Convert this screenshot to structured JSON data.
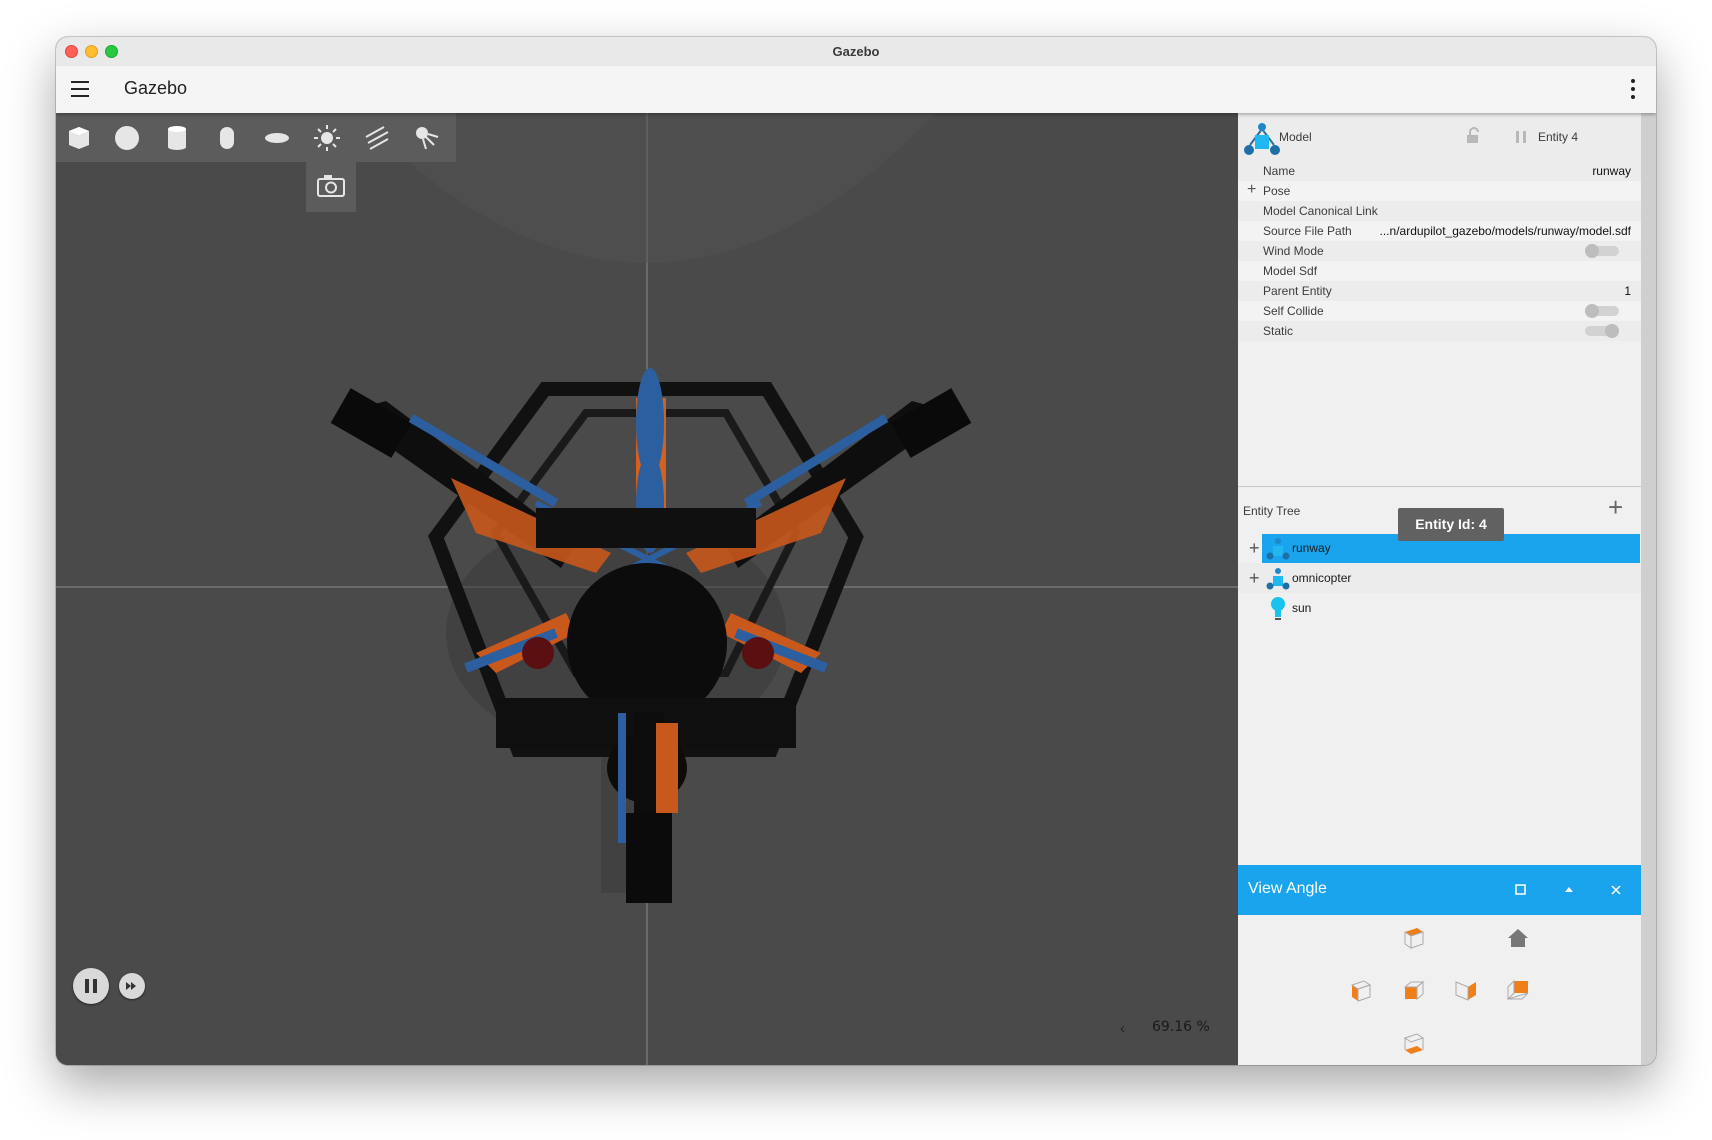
{
  "window": {
    "title": "Gazebo"
  },
  "appbar": {
    "title": "Gazebo",
    "menu_icon": "hamburger-icon",
    "overflow_icon": "kebab-menu-icon"
  },
  "toolbar": {
    "shapes": [
      "box",
      "sphere",
      "cylinder",
      "capsule",
      "ellipsoid",
      "sun-light",
      "directional-light",
      "spot-light"
    ],
    "screenshot": "camera-icon"
  },
  "playback": {
    "play_pause": "pause-icon",
    "step": "fast-forward-icon"
  },
  "stats": {
    "real_time_factor": "69.16 %",
    "collapse_arrow": "‹"
  },
  "component_inspector": {
    "type": "Model",
    "entity": "Entity 4",
    "rows": [
      {
        "key": "Name",
        "value": "runway"
      },
      {
        "key": "Pose",
        "value": ""
      },
      {
        "key": "Model Canonical Link",
        "value": ""
      },
      {
        "key": "Source File Path",
        "value": "...n/ardupilot_gazebo/models/runway/model.sdf"
      },
      {
        "key": "Wind Mode",
        "value": ""
      },
      {
        "key": "Model Sdf",
        "value": ""
      },
      {
        "key": "Parent Entity",
        "value": "1"
      },
      {
        "key": "Self Collide",
        "value": ""
      },
      {
        "key": "Static",
        "value": ""
      }
    ],
    "toggles": {
      "wind_mode": false,
      "self_collide": false,
      "static": true
    }
  },
  "entity_tree": {
    "title": "Entity Tree",
    "tooltip": "Entity Id: 4",
    "items": [
      {
        "label": "runway",
        "selected": true
      },
      {
        "label": "omnicopter",
        "selected": false
      },
      {
        "label": "sun",
        "selected": false
      }
    ]
  },
  "view_angle": {
    "title": "View Angle"
  },
  "colors": {
    "accent": "#1aa4ee",
    "view_orange": "#f07f1a",
    "viewport": "#4a4a4a"
  }
}
